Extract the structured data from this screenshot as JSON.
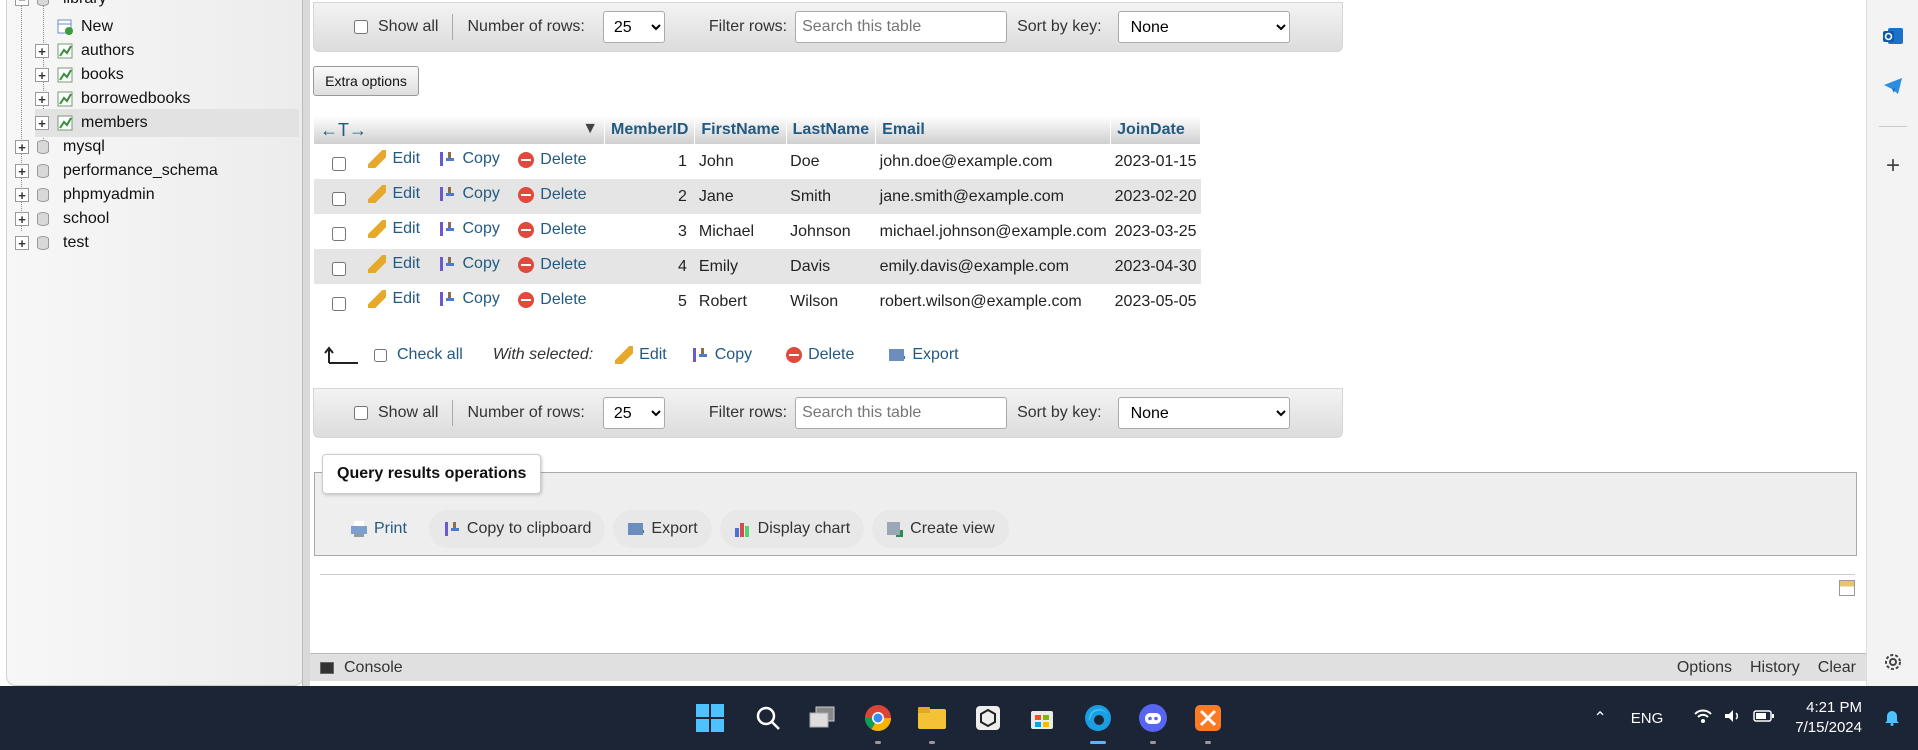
{
  "nav": {
    "root_db": "library",
    "tables": [
      {
        "label": "New"
      },
      {
        "label": "authors"
      },
      {
        "label": "books"
      },
      {
        "label": "borrowedbooks"
      },
      {
        "label": "members"
      }
    ],
    "databases": [
      "mysql",
      "performance_schema",
      "phpmyadmin",
      "school",
      "test"
    ]
  },
  "navbar": {
    "show_all": "Show all",
    "num_rows_label": "Number of rows:",
    "num_rows_value": "25",
    "filter_label": "Filter rows:",
    "filter_placeholder": "Search this table",
    "sort_label": "Sort by key:",
    "sort_value": "None"
  },
  "extra_options": "Extra options",
  "table": {
    "nav_arrows": "←T→",
    "columns": [
      "MemberID",
      "FirstName",
      "LastName",
      "Email",
      "JoinDate"
    ],
    "actions": {
      "edit": "Edit",
      "copy": "Copy",
      "delete": "Delete"
    },
    "rows": [
      {
        "id": "1",
        "first": "John",
        "last": "Doe",
        "email": "john.doe@example.com",
        "date": "2023-01-15"
      },
      {
        "id": "2",
        "first": "Jane",
        "last": "Smith",
        "email": "jane.smith@example.com",
        "date": "2023-02-20"
      },
      {
        "id": "3",
        "first": "Michael",
        "last": "Johnson",
        "email": "michael.johnson@example.com",
        "date": "2023-03-25"
      },
      {
        "id": "4",
        "first": "Emily",
        "last": "Davis",
        "email": "emily.davis@example.com",
        "date": "2023-04-30"
      },
      {
        "id": "5",
        "first": "Robert",
        "last": "Wilson",
        "email": "robert.wilson@example.com",
        "date": "2023-05-05"
      }
    ]
  },
  "bulk": {
    "check_all": "Check all",
    "with_selected": "With selected:",
    "edit": "Edit",
    "copy": "Copy",
    "delete": "Delete",
    "export": "Export"
  },
  "qro": {
    "title": "Query results operations",
    "items": [
      "Print",
      "Copy to clipboard",
      "Export",
      "Display chart",
      "Create view"
    ]
  },
  "console": {
    "label": "Console",
    "options": "Options",
    "history": "History",
    "clear": "Clear"
  },
  "tray": {
    "language": "ENG",
    "time": "4:21 PM",
    "date": "7/15/2024"
  },
  "colors": {
    "link": "#235a81",
    "taskbar": "#1c2536"
  }
}
